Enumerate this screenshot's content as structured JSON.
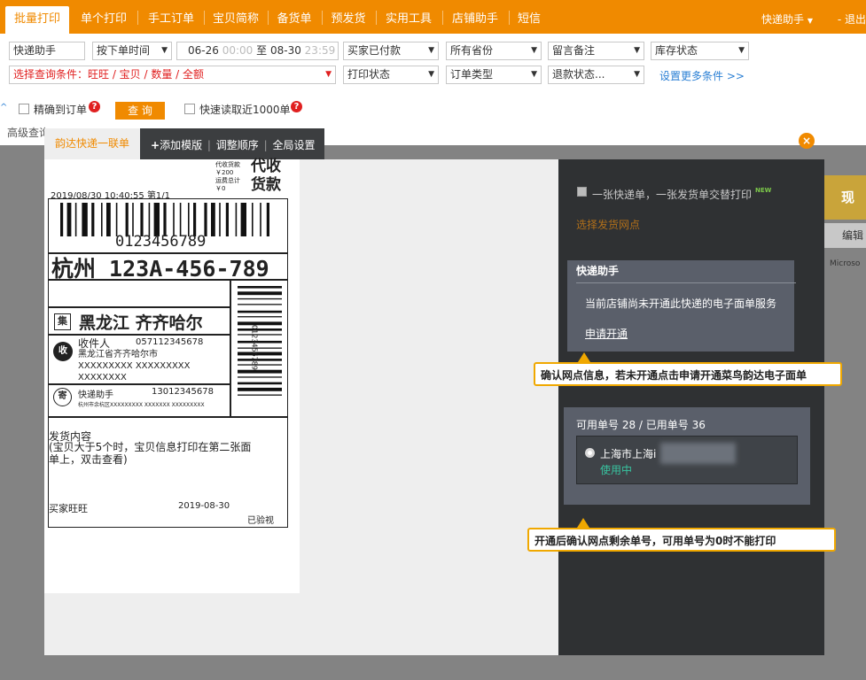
{
  "nav": {
    "tabs": [
      "批量打印",
      "单个打印",
      "手工订单",
      "宝贝简称",
      "备货单",
      "预发货",
      "实用工具",
      "店铺助手",
      "短信"
    ],
    "user": "快递助手",
    "logout": "退出"
  },
  "filters": {
    "row1": {
      "shop": "快递助手",
      "time_type": "按下单时间",
      "date_start": "06-26",
      "time_start": "00:00",
      "date_sep": "至",
      "date_end": "08-30",
      "time_end": "23:59",
      "status": "买家已付款",
      "province": "所有省份",
      "remark": "留言备注",
      "stock": "库存状态"
    },
    "row2": {
      "condition": "选择查询条件：旺旺 / 宝贝 / 数量 / 全额",
      "print_status": "打印状态",
      "order_type": "订单类型",
      "refund": "退款状态...",
      "more": "设置更多条件 >>"
    },
    "row3": {
      "exact_label": "精确到订单",
      "query_button": "查 询",
      "fast_label": "快速读取近1000单",
      "advanced": "高级查询"
    }
  },
  "modal": {
    "active_tab": "韵达快递一联单",
    "add_template": "添加模版",
    "reorder": "调整顺序",
    "global_settings": "全局设置",
    "close": "×",
    "waybill": {
      "date_line": "2019/08/30  10:40:55  第1/1",
      "cod_small_1": "代收货款",
      "cod_small_2": "￥200",
      "cod_small_3": "运费总计",
      "cod_small_4": "￥0",
      "cod_big_1": "代收",
      "cod_big_2": "货款",
      "barcode_number": "0123456789",
      "route_code": "杭州 123A-456-789",
      "collect_tag": "集",
      "destination": "黑龙江 齐齐哈尔",
      "recipient_tag": "收",
      "recipient_label": "收件人",
      "recipient_phone": "0571123456",
      "recipient_phone_suffix": "78",
      "recipient_addr1": "黑龙江省齐齐哈尔市",
      "recipient_addr2": "XXXXXXXXX XXXXXXXXX",
      "recipient_addr3": "XXXXXXXX",
      "sender_tag": "寄",
      "sender_name": "快递助手",
      "sender_phone": "13012345678",
      "sender_addr": "杭州市余杭区XXXXXXXXX XXXXXXX XXXXXXXXX",
      "vertical_number": "0123456789",
      "content_label": "发货内容",
      "content_note_1": "(宝贝大于5个时，宝贝信息打印在第二张面",
      "content_note_2": "单上，双击查看)",
      "buyer": "买家旺旺",
      "footer_date": "2019-08-30",
      "inspected": "已验视"
    },
    "panel": {
      "alternate_label": "一张快递单，一张发货单交替打印",
      "new_tag": "NEW",
      "select_site": "选择发货网点",
      "info_title": "快递助手",
      "info_message": "当前店铺尚未开通此快递的电子面单服务",
      "apply_link": "申请开通",
      "callout1": "确认网点信息，若未开通点击申请开通菜鸟韵达电子面单",
      "numbers": "可用单号 28 / 已用单号 36",
      "site_name": "上海市上海i",
      "in_use": "使用中",
      "callout2": "开通后确认网点剩余单号，可用单号为0时不能打印"
    }
  },
  "background_right": {
    "button": "现在",
    "edit": "编辑",
    "ms": "Microso"
  },
  "colors": {
    "brand_orange": "#f08a00",
    "panel_dark": "#2f3133",
    "info_box": "#5a5f6a",
    "in_use_green": "#38c4a0",
    "callout_border": "#f0a800"
  }
}
